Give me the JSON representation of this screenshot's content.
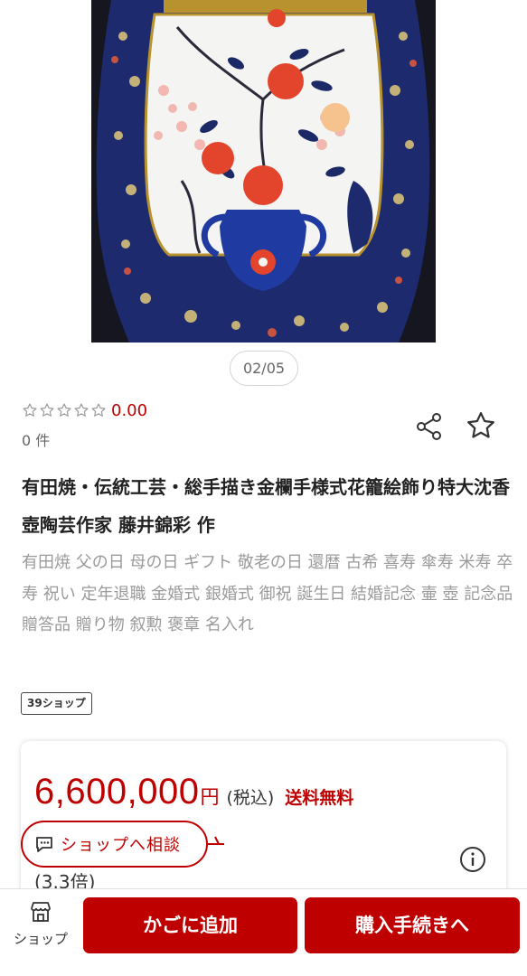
{
  "gallery": {
    "page_indicator": "02/05"
  },
  "rating": {
    "stars_filled": 0,
    "stars_total": 5,
    "value": "0.00",
    "count": "0 件"
  },
  "product": {
    "title": "有田焼・伝統工芸・総手描き金欄手様式花籠絵飾り特大沈香壺陶芸作家 藤井錦彩 作",
    "tags": "有田焼 父の日 母の日 ギフト 敬老の日 還暦 古希 喜寿 傘寿 米寿 卒寿 祝い 定年退職 金婚式 銀婚式 御祝 誕生日 結婚記念 壷 壺 記念品 贈答品 贈り物 叙勲 褒章 名入れ",
    "shop_badge": "39ショップ"
  },
  "price": {
    "amount": "6,600,000",
    "unit": "円",
    "tax": "(税込)",
    "shipping": "送料無料",
    "multiplier": "(3.3倍)"
  },
  "consult": {
    "label": "ショップへ相談"
  },
  "bottom_bar": {
    "shop_label": "ショップ",
    "cart_label": "かごに追加",
    "checkout_label": "購入手続きへ"
  },
  "icons": {
    "share": "share-icon",
    "favorite": "star-outline-icon",
    "info": "info-icon",
    "consult": "chat-bubble-icon",
    "shop": "storefront-icon"
  },
  "colors": {
    "accent": "#bf0000",
    "muted_text": "#9a9a9a",
    "star_outline": "#9a9a9a"
  }
}
